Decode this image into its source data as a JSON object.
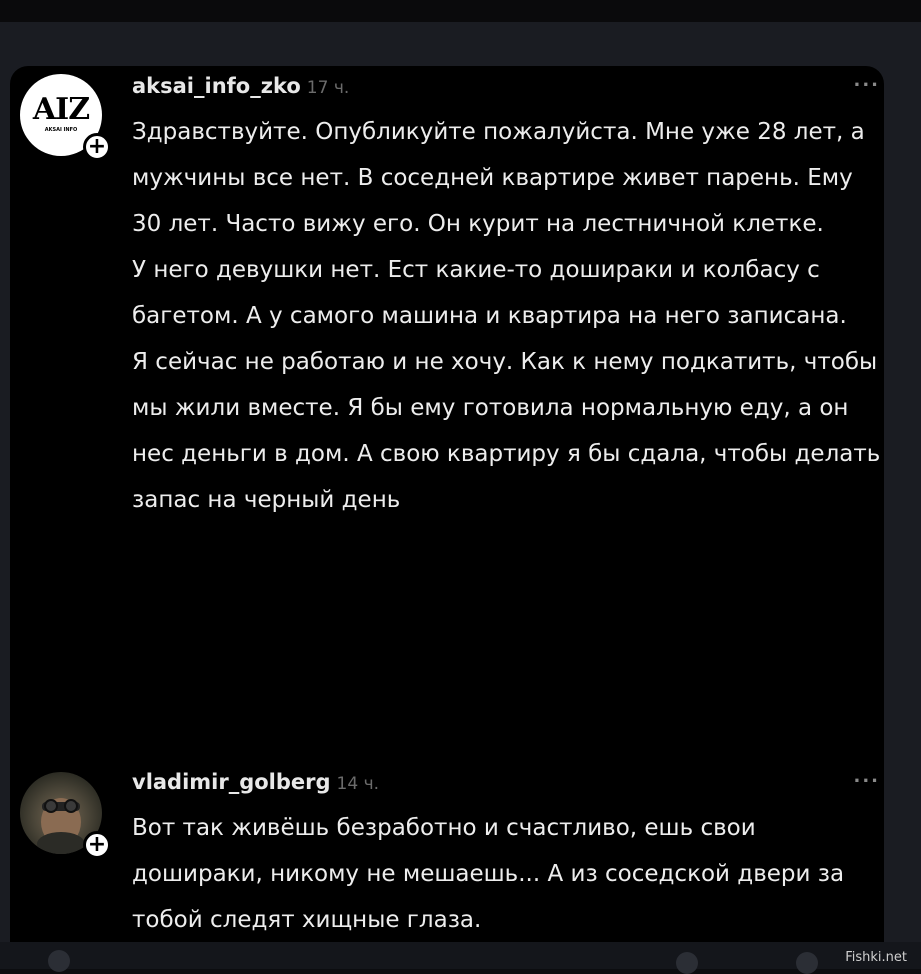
{
  "comments": [
    {
      "avatar_text": "AIZ",
      "avatar_subtext": "AKSAI INFO",
      "username": "aksai_info_zko",
      "time": "17 ч.",
      "more": "...",
      "paragraphs": [
        "Здравствуйте. Опубликуйте пожалуйста. Мне уже 28 лет, а мужчины все нет. В соседней квартире живет парень. Ему 30 лет. Часто вижу его. Он курит на лестничной клетке.",
        "У него девушки нет. Ест какие-то дошираки и колбасу с багетом. А у самого машина и квартира на него записана.",
        "Я сейчас не работаю и не хочу. Как к нему подкатить, чтобы мы жили вместе. Я бы ему готовила нормальную еду, а он нес деньги в дом. А свою квартиру я бы сдала, чтобы делать запас на черный день"
      ]
    },
    {
      "username": "vladimir_golberg",
      "time": "14 ч.",
      "more": "...",
      "paragraphs": [
        "Вот так живёшь безработно и счастливо, ешь свои дошираки, никому не мешаешь... А из соседской двери за тобой следят хищные глаза."
      ]
    }
  ],
  "follow_symbol": "+",
  "watermark": "Fishki.net",
  "icons": [
    "plus-icon",
    "more-options-icon"
  ]
}
